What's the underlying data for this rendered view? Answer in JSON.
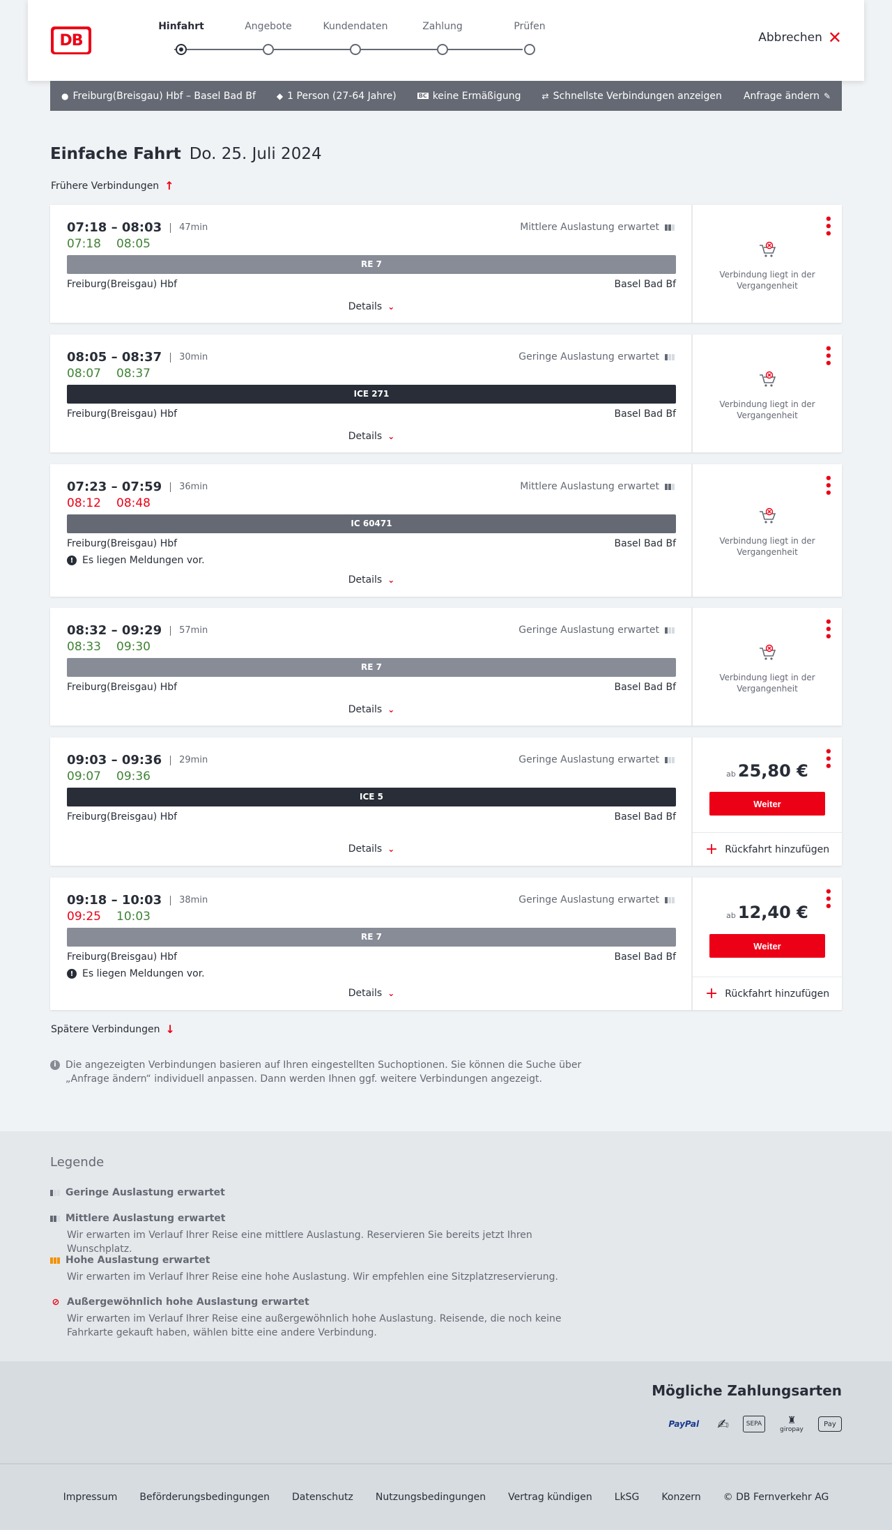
{
  "header": {
    "steps": [
      {
        "label": "Hinfahrt"
      },
      {
        "label": "Angebote"
      },
      {
        "label": "Kundendaten"
      },
      {
        "label": "Zahlung"
      },
      {
        "label": "Prüfen"
      }
    ],
    "active_step": 0,
    "cancel_label": "Abbrechen",
    "logo_text": "DB"
  },
  "summary": {
    "route": "Freiburg(Breisgau) Hbf – Basel Bad Bf",
    "passengers": "1 Person (27-64 Jahre)",
    "discount": "keine Ermäßigung",
    "option": "Schnellste Verbindungen anzeigen",
    "change_label": "Anfrage ändern",
    "discount_badge": "BC"
  },
  "title": {
    "type": "Einfache Fahrt",
    "date": "Do. 25. Juli 2024"
  },
  "earlier_label": "Frühere Verbindungen",
  "later_label": "Spätere Verbindungen",
  "details_label": "Details",
  "past_label": "Verbindung liegt in der Vergangenheit",
  "notice_label": "Es liegen Meldungen vor.",
  "return_label": "Rückfahrt hinzufügen",
  "button_label": "Weiter",
  "price_prefix": "ab",
  "connections": [
    {
      "times": "07:18 – 08:03",
      "duration": "47min",
      "real_dep": "07:18",
      "real_arr": "08:05",
      "load": "Mittlere Auslastung erwartet",
      "train": "RE 7",
      "from": "Freiburg(Breisgau) Hbf",
      "to": "Basel Bad Bf"
    },
    {
      "times": "08:05 – 08:37",
      "duration": "30min",
      "real_dep": "08:07",
      "real_arr": "08:37",
      "load": "Geringe Auslastung erwartet",
      "train": "ICE 271",
      "from": "Freiburg(Breisgau) Hbf",
      "to": "Basel Bad Bf"
    },
    {
      "times": "07:23 – 07:59",
      "duration": "36min",
      "real_dep": "08:12",
      "real_arr": "08:48",
      "load": "Mittlere Auslastung erwartet",
      "train": "IC 60471",
      "from": "Freiburg(Breisgau) Hbf",
      "to": "Basel Bad Bf"
    },
    {
      "times": "08:32 – 09:29",
      "duration": "57min",
      "real_dep": "08:33",
      "real_arr": "09:30",
      "load": "Geringe Auslastung erwartet",
      "train": "RE 7",
      "from": "Freiburg(Breisgau) Hbf",
      "to": "Basel Bad Bf"
    },
    {
      "times": "09:03 – 09:36",
      "duration": "29min",
      "real_dep": "09:07",
      "real_arr": "09:36",
      "load": "Geringe Auslastung erwartet",
      "train": "ICE 5",
      "from": "Freiburg(Breisgau) Hbf",
      "to": "Basel Bad Bf",
      "price": "25,80 €"
    },
    {
      "times": "09:18 – 10:03",
      "duration": "38min",
      "real_dep": "09:25",
      "real_arr": "10:03",
      "load": "Geringe Auslastung erwartet",
      "train": "RE 7",
      "from": "Freiburg(Breisgau) Hbf",
      "to": "Basel Bad Bf",
      "price": "12,40 €"
    }
  ],
  "info_text": "Die angezeigten Verbindungen basieren auf Ihren eingestellten Suchoptionen. Sie können die Suche über „Anfrage ändern“ individuell anpassen. Dann werden Ihnen ggf. weitere Verbindungen angezeigt.",
  "legend": {
    "title": "Legende",
    "items": [
      {
        "title": "Geringe Auslastung erwartet",
        "desc": ""
      },
      {
        "title": "Mittlere Auslastung erwartet",
        "desc": "Wir erwarten im Verlauf Ihrer Reise eine mittlere Auslastung. Reservieren Sie bereits jetzt Ihren Wunschplatz."
      },
      {
        "title": "Hohe Auslastung erwartet",
        "desc": "Wir erwarten im Verlauf Ihrer Reise eine hohe Auslastung. Wir empfehlen eine Sitzplatzreservierung."
      },
      {
        "title": "Außergewöhnlich hohe Auslastung erwartet",
        "desc": "Wir erwarten im Verlauf Ihrer Reise eine außergewöhnlich hohe Auslastung. Reisende, die noch keine Fahrkarte gekauft haben, wählen bitte eine andere Verbindung."
      }
    ]
  },
  "payment": {
    "title": "Mögliche Zahlungsarten",
    "methods": [
      "PayPal",
      "SEPA",
      "giropay",
      "Pay"
    ]
  },
  "footer": [
    "Impressum",
    "Beförderungsbedingungen",
    "Datenschutz",
    "Nutzungsbedingungen",
    "Vertrag kündigen",
    "LkSG",
    "Konzern",
    "© DB Fernverkehr AG"
  ],
  "colors": {
    "brand_red": "#ec0016",
    "on_time_green": "#408335",
    "summary_bg": "#646973"
  }
}
